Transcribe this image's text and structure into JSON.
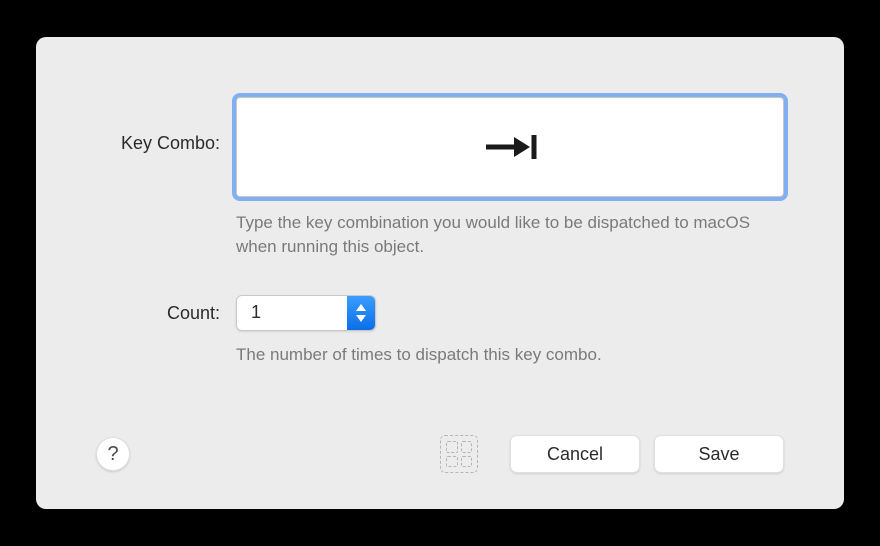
{
  "keyCombo": {
    "label": "Key Combo:",
    "symbol": "⇥",
    "hint": "Type the key combination you would like to be dispatched to macOS when running this object."
  },
  "count": {
    "label": "Count:",
    "value": "1",
    "hint": "The number of times to dispatch this key combo."
  },
  "help": {
    "symbol": "?"
  },
  "buttons": {
    "cancel": "Cancel",
    "save": "Save"
  }
}
